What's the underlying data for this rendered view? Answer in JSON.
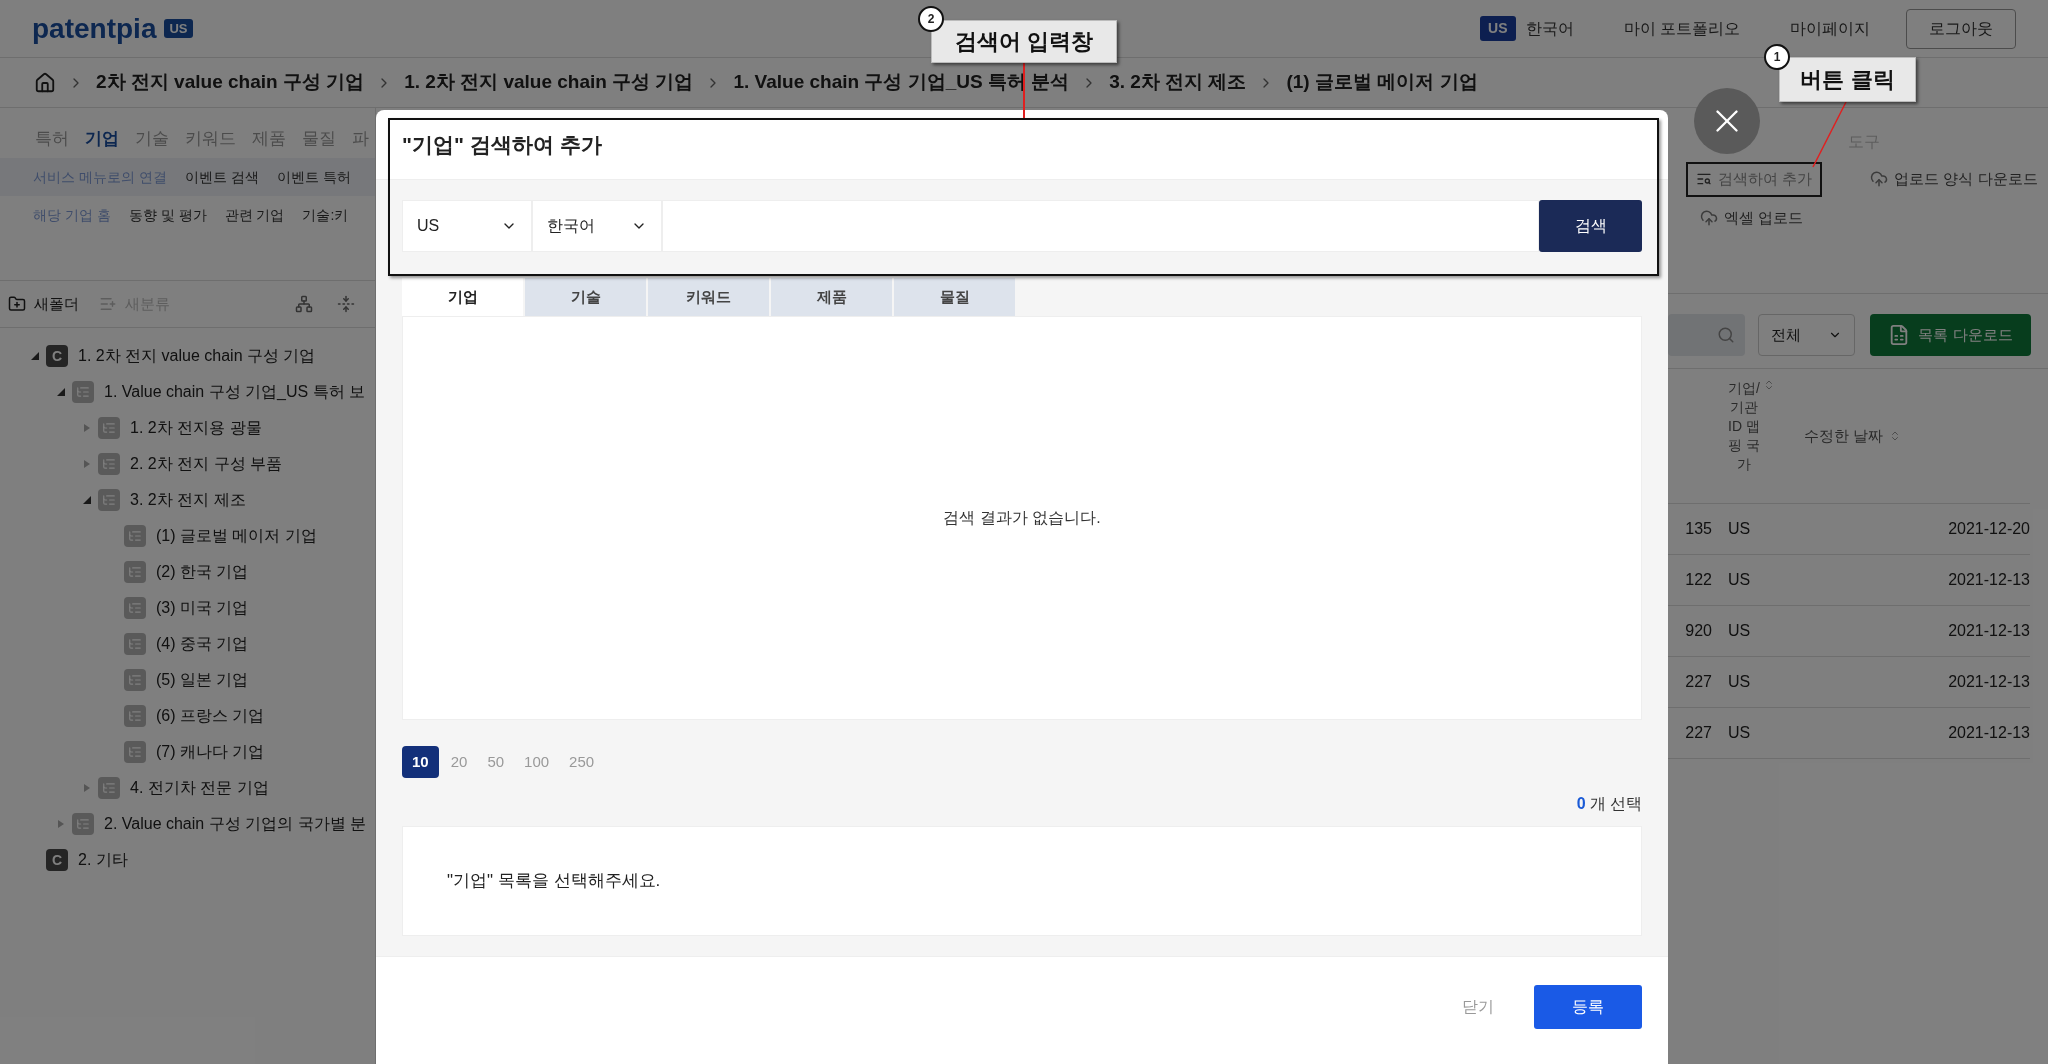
{
  "header": {
    "logo": "patentpia",
    "logo_badge": "US",
    "region_badge": "US",
    "language": "한국어",
    "links": [
      "마이 포트폴리오",
      "마이페이지"
    ],
    "logout": "로그아웃"
  },
  "breadcrumb": [
    "2차 전지 value chain 구성 기업",
    "1. 2차 전지 value chain 구성 기업",
    "1. Value chain 구성 기업_US 특허 분석",
    "3. 2차 전지 제조",
    "(1) 글로벌 메이저 기업"
  ],
  "menu": {
    "tabs": [
      {
        "label": "특허",
        "selected": false
      },
      {
        "label": "기업",
        "selected": true
      },
      {
        "label": "기술",
        "selected": false
      },
      {
        "label": "키워드",
        "selected": false
      },
      {
        "label": "제품",
        "selected": false
      },
      {
        "label": "물질",
        "selected": false
      },
      {
        "label": "파",
        "selected": false
      }
    ],
    "row_2": [
      {
        "label": "서비스 메뉴로의 연결",
        "selected": true
      },
      {
        "label": "이벤트 검색",
        "selected": false
      },
      {
        "label": "이벤트 특허",
        "selected": false
      }
    ],
    "row_3": [
      {
        "label": "해당 기업 홈",
        "selected": true
      },
      {
        "label": "동향 및 평가",
        "selected": false
      },
      {
        "label": "관련 기업",
        "selected": false
      },
      {
        "label": "기술:키",
        "selected": false
      }
    ]
  },
  "tree_toolbar": {
    "new_folder": "새폴더",
    "new_category": {
      "label": "새분류",
      "disabled": true
    }
  },
  "tree": [
    {
      "label": "1. 2차 전지 value chain 구성 기업",
      "badge": "C",
      "kind": "branch",
      "expanded": true,
      "children": [
        {
          "label": "1. Value chain 구성 기업_US 특허 보",
          "kind": "branch",
          "expanded": true,
          "children": [
            {
              "label": "1. 2차 전지용 광물",
              "kind": "branch",
              "expanded": false
            },
            {
              "label": "2. 2차 전지 구성 부품",
              "kind": "branch",
              "expanded": false
            },
            {
              "label": "3. 2차 전지 제조",
              "kind": "branch",
              "expanded": true,
              "children": [
                {
                  "label": "(1) 글로벌 메이저 기업",
                  "kind": "leaf"
                },
                {
                  "label": "(2) 한국 기업",
                  "kind": "leaf"
                },
                {
                  "label": "(3) 미국 기업",
                  "kind": "leaf"
                },
                {
                  "label": "(4) 중국 기업",
                  "kind": "leaf"
                },
                {
                  "label": "(5) 일본 기업",
                  "kind": "leaf"
                },
                {
                  "label": "(6) 프랑스 기업",
                  "kind": "leaf"
                },
                {
                  "label": "(7) 캐나다 기업",
                  "kind": "leaf"
                }
              ]
            },
            {
              "label": "4. 전기차 전문 기업",
              "kind": "branch",
              "expanded": false
            }
          ]
        },
        {
          "label": "2. Value chain 구성 기업의 국가별 분",
          "kind": "branch",
          "expanded": false
        }
      ]
    },
    {
      "label": "2. 기타",
      "badge": "C",
      "kind": "leaf"
    }
  ],
  "tools": {
    "title": "도구",
    "actions": [
      {
        "label": "검색하여 추가",
        "kind": "search",
        "framed": true
      },
      {
        "label": "업로드 양식 다운로드",
        "kind": "upload",
        "framed": false
      },
      {
        "label": "엑셀 업로드",
        "kind": "upload",
        "framed": false
      }
    ]
  },
  "list_toolbar": {
    "filter": "전체",
    "download": "목록 다운로드"
  },
  "table": {
    "columns": [
      "기업/기관 ID 맵핑 국가",
      "수정한 날짜"
    ],
    "rows": [
      {
        "column_1": "135",
        "country": "US",
        "date": "2021-12-20"
      },
      {
        "column_1": "122",
        "country": "US",
        "date": "2021-12-13"
      },
      {
        "column_1": "920",
        "country": "US",
        "date": "2021-12-13"
      },
      {
        "column_1": "227",
        "country": "US",
        "date": "2021-12-13"
      },
      {
        "column_1": "227",
        "country": "US",
        "date": "2021-12-13"
      }
    ]
  },
  "modal": {
    "title": "\"기업\" 검색하여 추가",
    "framed": true,
    "country": "US",
    "language": "한국어",
    "search_button": "검색",
    "tabs": [
      {
        "label": "기업",
        "selected": true
      },
      {
        "label": "기술",
        "selected": false
      },
      {
        "label": "키워드",
        "selected": false
      },
      {
        "label": "제품",
        "selected": false
      },
      {
        "label": "물질",
        "selected": false
      }
    ],
    "empty_message": "검색 결과가 없습니다.",
    "page_sizes": [
      {
        "label": "10",
        "selected": true
      },
      {
        "label": "20",
        "selected": false
      },
      {
        "label": "50",
        "selected": false
      },
      {
        "label": "100",
        "selected": false
      },
      {
        "label": "250",
        "selected": false
      }
    ],
    "selected_count": "0",
    "selected_label": "개 선택",
    "selection_message": "\"기업\" 목록을 선택해주세요.",
    "close_button": "닫기",
    "submit_button": "등록"
  },
  "annotations": [
    {
      "number": "2",
      "label": "검색어 입력창"
    },
    {
      "number": "1",
      "label": "버튼 클릭"
    }
  ]
}
